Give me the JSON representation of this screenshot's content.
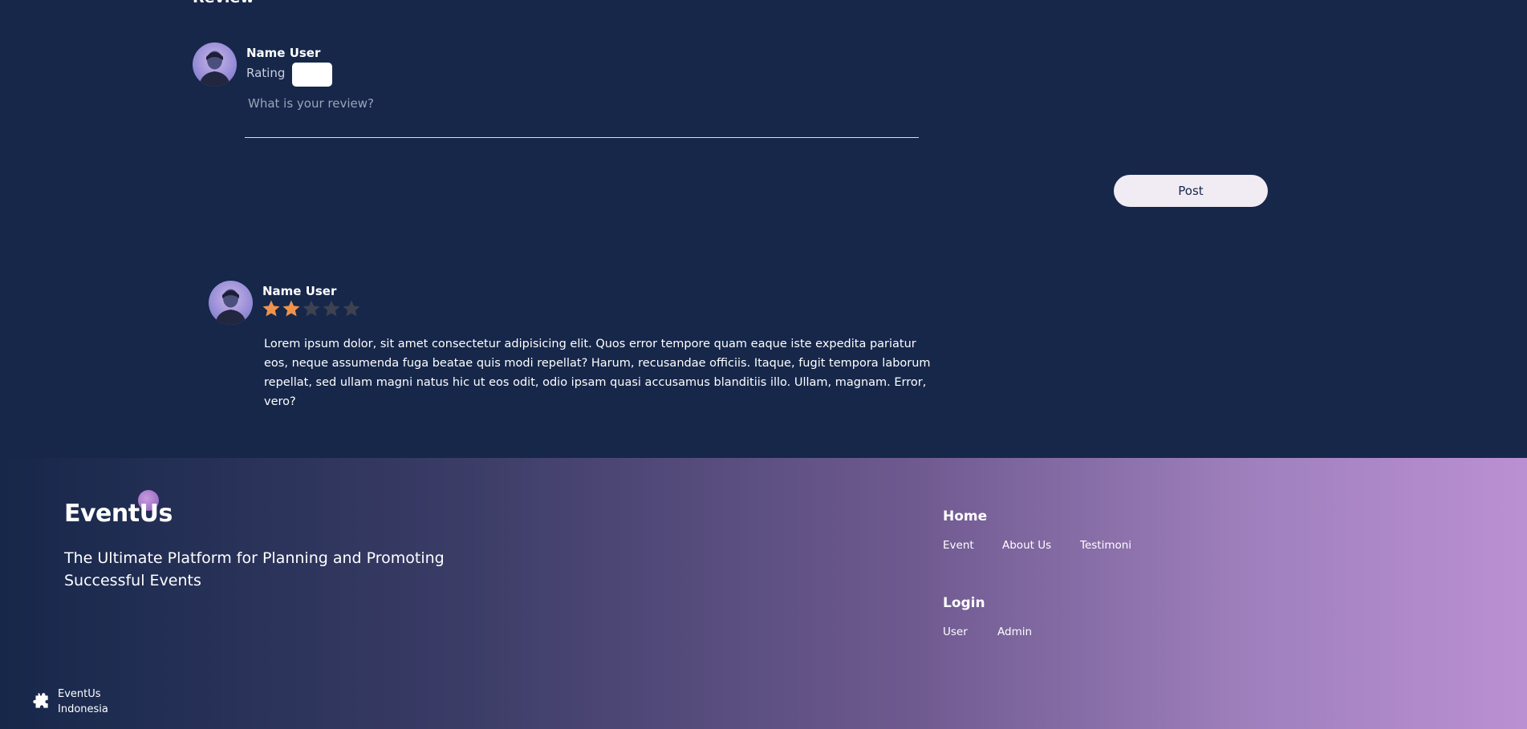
{
  "review_section": {
    "title": "Review"
  },
  "review_form": {
    "user_name": "Name User",
    "rating_label": "Rating",
    "review_placeholder": "What is your review?",
    "post_label": "Post"
  },
  "review_card": {
    "user_name": "Name User",
    "rating": 2,
    "rating_max": 5,
    "text": "Lorem ipsum dolor, sit amet consectetur adipisicing elit. Quos error tempore quam eaque iste expedita pariatur eos, neque assumenda fuga beatae quis modi repellat? Harum, recusandae officiis. Itaque, fugit tempora laborum repellat, sed ullam magni natus hic ut eos odit, odio ipsam quasi accusamus blanditiis illo. Ullam, magnam. Error, vero?"
  },
  "footer": {
    "logo_text": "EventUs",
    "tagline": "The Ultimate Platform for Planning and Promoting Successful Events",
    "nav_home": {
      "heading": "Home",
      "links": [
        "Event",
        "About Us",
        "Testimoni"
      ]
    },
    "nav_login": {
      "heading": "Login",
      "links": [
        "User",
        "Admin"
      ]
    },
    "copyright": {
      "line1": "EventUs",
      "line2": "Indonesia"
    }
  },
  "colors": {
    "background": "#16274a",
    "star_filled": "#f0924a",
    "star_empty": "#3d4150",
    "post_button_bg": "#f1ebf4",
    "footer_gradient_end": "#bb90d3"
  }
}
